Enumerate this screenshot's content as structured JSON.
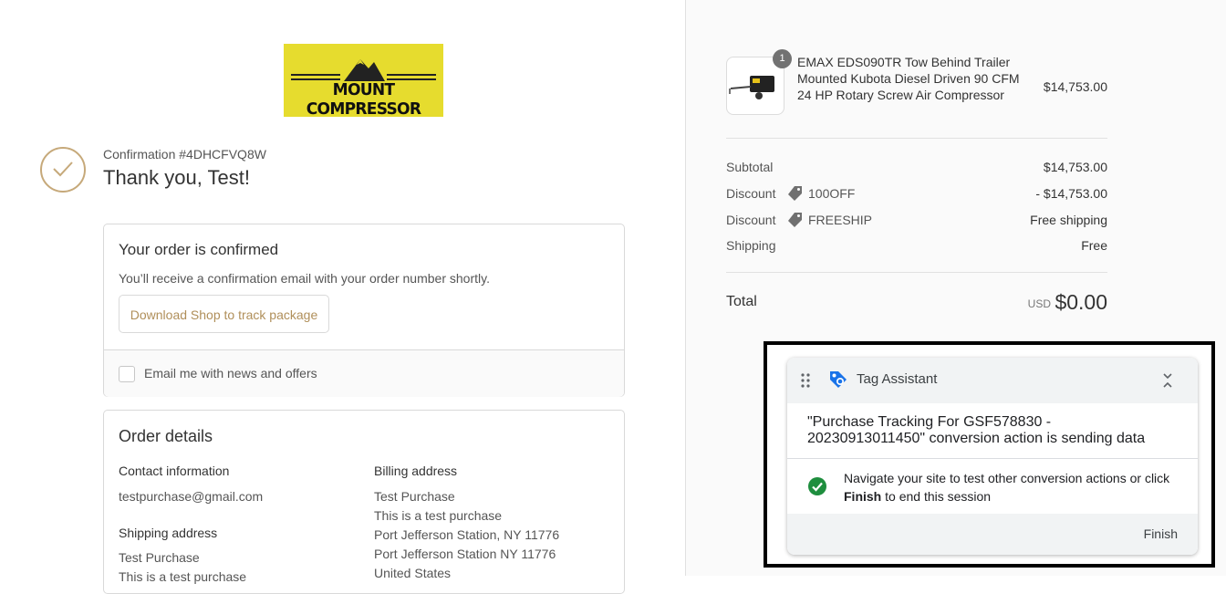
{
  "brand": {
    "logo_text": "MOUNT COMPRESSOR",
    "logo_bg": "#e6dc2e"
  },
  "confirmation": {
    "number": "Confirmation #4DHCFVQ8W",
    "greeting": "Thank you, Test!"
  },
  "order_confirmed": {
    "title": "Your order is confirmed",
    "subtitle": "You’ll receive a confirmation email with your order number shortly.",
    "shop_button": "Download Shop to track package",
    "newsletter_label": "Email me with news and offers"
  },
  "order_details": {
    "title": "Order details",
    "contact_heading": "Contact information",
    "contact_email": "testpurchase@gmail.com",
    "shipping_heading": "Shipping address",
    "shipping_lines": [
      "Test Purchase",
      "This is a test purchase"
    ],
    "billing_heading": "Billing address",
    "billing_lines": [
      "Test Purchase",
      "This is a test purchase",
      "Port Jefferson Station, NY 11776",
      "Port Jefferson Station NY 11776",
      "United States"
    ]
  },
  "summary": {
    "product": {
      "quantity": "1",
      "name": "EMAX EDS090TR Tow Behind Trailer Mounted Kubota Diesel Driven 90 CFM 24 HP Rotary Screw Air Compressor",
      "price": "$14,753.00"
    },
    "subtotal_label": "Subtotal",
    "subtotal_value": "$14,753.00",
    "discounts": [
      {
        "label": "Discount",
        "code": "100OFF",
        "value": "- $14,753.00"
      },
      {
        "label": "Discount",
        "code": "FREESHIP",
        "value": "Free shipping"
      }
    ],
    "shipping_label": "Shipping",
    "shipping_value": "Free",
    "total_label": "Total",
    "currency": "USD",
    "total_value": "$0.00"
  },
  "tag_assistant": {
    "title": "Tag Assistant",
    "message": "\"Purchase Tracking For GSF578830 - 20230913011450\" conversion action is sending data",
    "info_before": "Navigate your site to test other conversion actions or click ",
    "info_bold": "Finish",
    "info_after": " to end this session",
    "finish_label": "Finish"
  },
  "colors": {
    "accent": "#b08f5a",
    "success": "#1e8e3e",
    "ta_blue": "#1a73e8"
  }
}
